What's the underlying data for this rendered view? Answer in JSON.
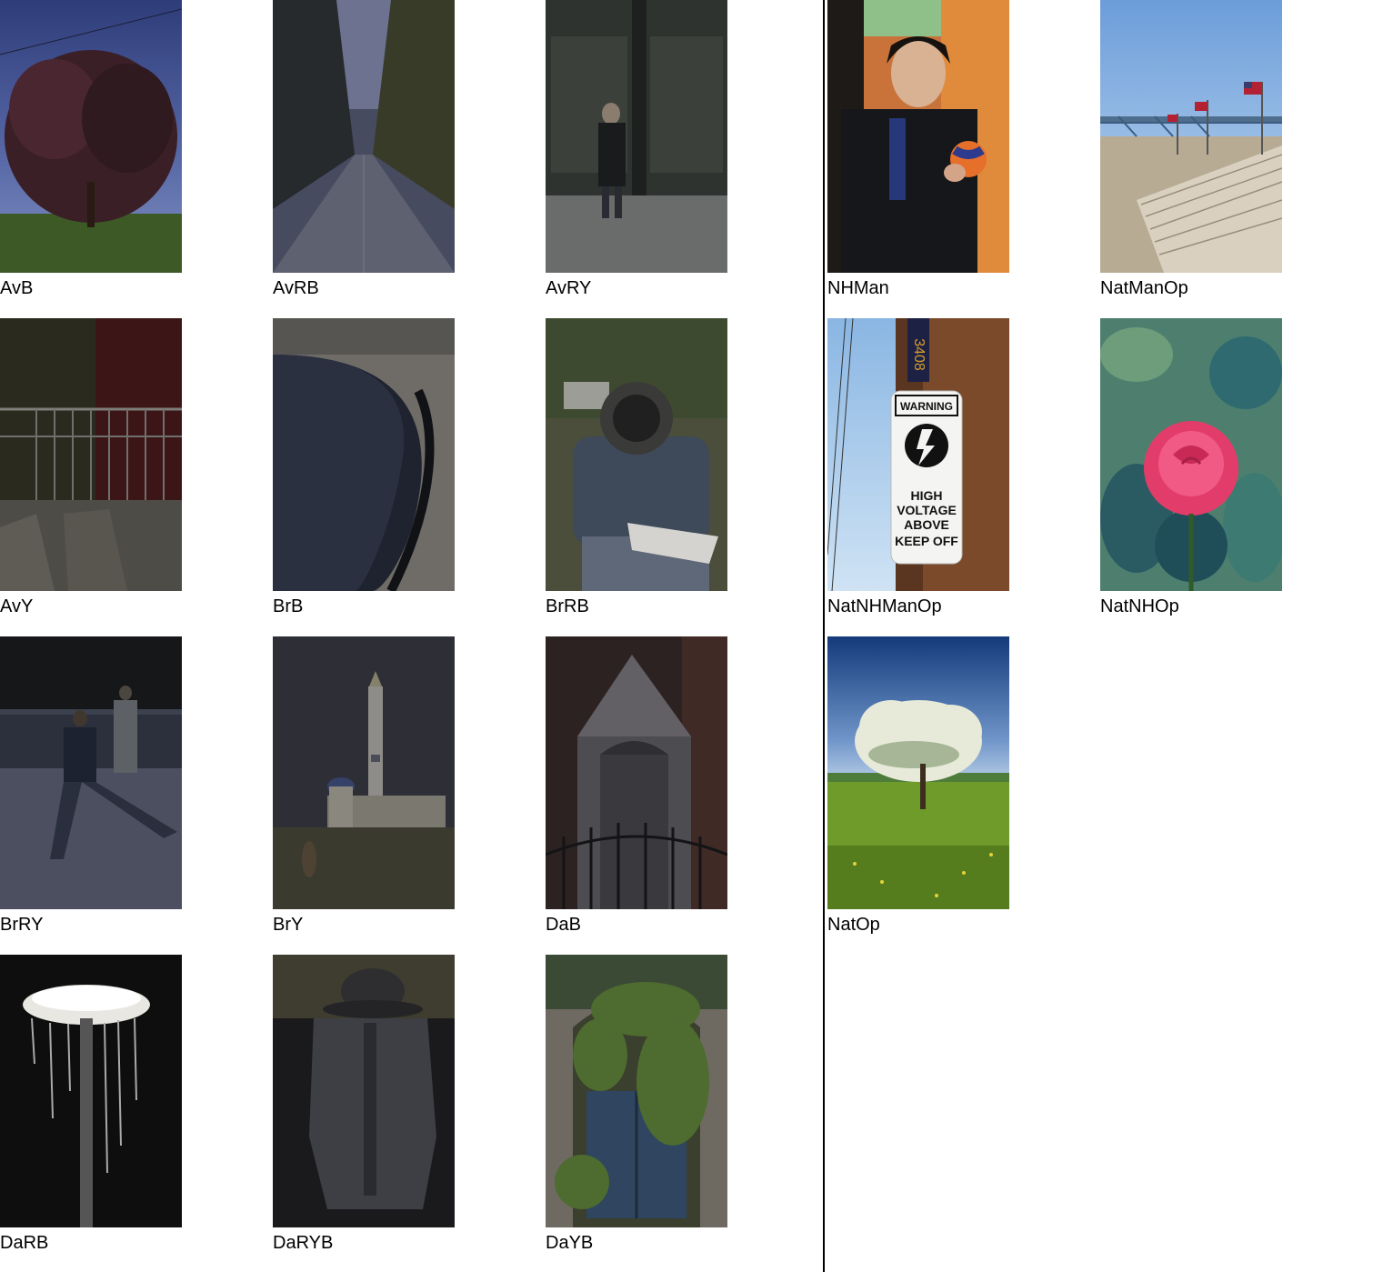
{
  "left_panel": {
    "items": [
      {
        "label": "AvB"
      },
      {
        "label": "AvRB"
      },
      {
        "label": "AvRY"
      },
      {
        "label": "AvY"
      },
      {
        "label": "BrB"
      },
      {
        "label": "BrRB"
      },
      {
        "label": "BrRY"
      },
      {
        "label": "BrY"
      },
      {
        "label": "DaB"
      },
      {
        "label": "DaRB"
      },
      {
        "label": "DaRYB"
      },
      {
        "label": "DaYB"
      }
    ]
  },
  "right_panel": {
    "items": [
      {
        "label": "NHMan"
      },
      {
        "label": "NatManOp"
      },
      {
        "label": "NatNHManOp"
      },
      {
        "label": "NatNHOp"
      },
      {
        "label": "NatOp"
      }
    ]
  },
  "sign_text": {
    "pole_number": "3408",
    "warning": "WARNING",
    "line1": "HIGH",
    "line2": "VOLTAGE",
    "line3": "ABOVE",
    "line4": "KEEP OFF"
  }
}
